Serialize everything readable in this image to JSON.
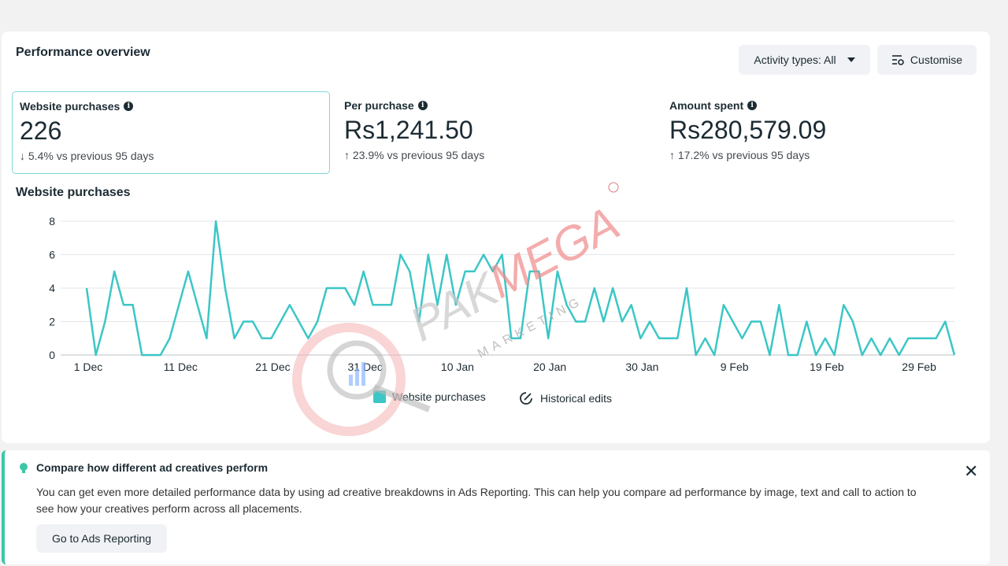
{
  "card": {
    "title": "Performance overview",
    "activity_label": "Activity types: All",
    "customise_label": "Customise"
  },
  "metrics": [
    {
      "label": "Website purchases",
      "value": "226",
      "arrow": "↓",
      "delta": "5.4% vs previous 95 days",
      "selected": true
    },
    {
      "label": "Per purchase",
      "value": "Rs1,241.50",
      "arrow": "↑",
      "delta": "23.9% vs previous 95 days",
      "selected": false
    },
    {
      "label": "Amount spent",
      "value": "Rs280,579.09",
      "arrow": "↑",
      "delta": "17.2% vs previous 95 days",
      "selected": false
    }
  ],
  "chart_section_title": "Website purchases",
  "chart_data": {
    "type": "line",
    "x_tick_labels": [
      "1 Dec",
      "11 Dec",
      "21 Dec",
      "31 Dec",
      "10 Jan",
      "20 Jan",
      "30 Jan",
      "9 Feb",
      "19 Feb",
      "29 Feb"
    ],
    "y_ticks": [
      0,
      2,
      4,
      6,
      8
    ],
    "ylim": [
      0,
      8
    ],
    "grid": true,
    "series": [
      {
        "name": "Website purchases",
        "color": "#3cc6c6",
        "values": [
          4,
          0,
          2,
          5,
          3,
          3,
          0,
          0,
          0,
          1,
          3,
          5,
          3,
          1,
          8,
          4,
          1,
          2,
          2,
          1,
          1,
          2,
          3,
          2,
          1,
          2,
          4,
          4,
          4,
          3,
          5,
          3,
          3,
          3,
          6,
          5,
          2,
          6,
          3,
          6,
          3,
          5,
          5,
          6,
          5,
          6,
          1,
          1,
          5,
          5,
          1,
          5,
          3,
          2,
          2,
          4,
          2,
          4,
          2,
          3,
          1,
          2,
          1,
          1,
          1,
          4,
          0,
          1,
          0,
          3,
          2,
          1,
          2,
          2,
          0,
          3,
          0,
          0,
          2,
          0,
          1,
          0,
          3,
          2,
          0,
          1,
          0,
          1,
          0,
          1,
          1,
          1,
          1,
          2,
          0
        ]
      }
    ],
    "legend": [
      {
        "label": "Website purchases",
        "icon": "square-swatch"
      },
      {
        "label": "Historical edits",
        "icon": "edit-history-icon"
      }
    ],
    "legend_position": "bottom-center"
  },
  "banner": {
    "title": "Compare how different ad creatives perform",
    "body": "You can get even more detailed performance data by using ad creative breakdowns in Ads Reporting. This can help you compare ad performance by image, text and call to action to see how your creatives perform across all placements.",
    "button_label": "Go to Ads Reporting",
    "close_icon": "close-icon",
    "icon": "lightbulb-icon"
  },
  "watermark": {
    "word1": "PAK",
    "word2": "MEGA",
    "tagline": "MARKETING",
    "color1": "#c8c8c8",
    "color2": "#f08a8a"
  }
}
